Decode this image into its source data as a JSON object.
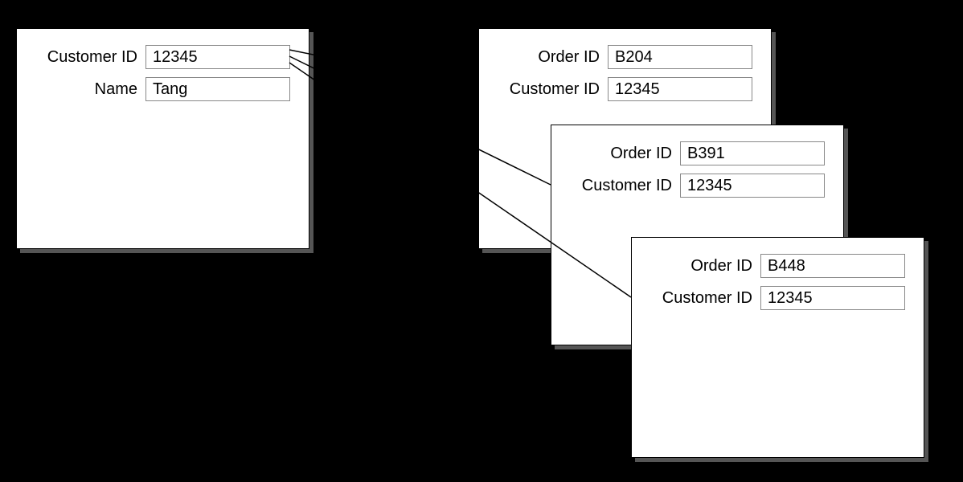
{
  "customer": {
    "fields": {
      "customer_id_label": "Customer ID",
      "customer_id_value": "12345",
      "name_label": "Name",
      "name_value": "Tang"
    }
  },
  "orders": [
    {
      "order_id_label": "Order ID",
      "order_id_value": "B204",
      "customer_id_label": "Customer ID",
      "customer_id_value": "12345"
    },
    {
      "order_id_label": "Order ID",
      "order_id_value": "B391",
      "customer_id_label": "Customer ID",
      "customer_id_value": "12345"
    },
    {
      "order_id_label": "Order ID",
      "order_id_value": "B448",
      "customer_id_label": "Customer ID",
      "customer_id_value": "12345"
    }
  ]
}
